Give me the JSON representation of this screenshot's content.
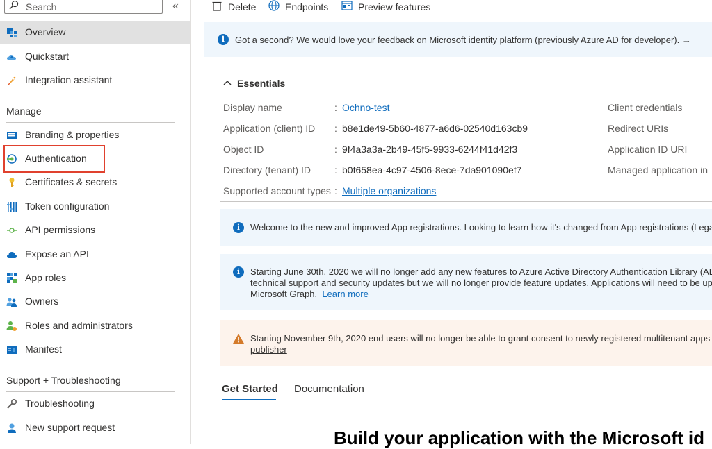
{
  "sidebar": {
    "search_placeholder": "Search",
    "collapse_glyph": "«",
    "items_top": [
      {
        "label": "Overview",
        "icon": "overview-icon"
      },
      {
        "label": "Quickstart",
        "icon": "quickstart-icon"
      },
      {
        "label": "Integration assistant",
        "icon": "rocket-icon"
      }
    ],
    "manage_heading": "Manage",
    "manage_items": [
      {
        "label": "Branding & properties",
        "icon": "branding-icon"
      },
      {
        "label": "Authentication",
        "icon": "authentication-icon"
      },
      {
        "label": "Certificates & secrets",
        "icon": "key-icon"
      },
      {
        "label": "Token configuration",
        "icon": "token-icon"
      },
      {
        "label": "API permissions",
        "icon": "api-permissions-icon"
      },
      {
        "label": "Expose an API",
        "icon": "cloud-icon"
      },
      {
        "label": "App roles",
        "icon": "app-roles-icon"
      },
      {
        "label": "Owners",
        "icon": "owners-icon"
      },
      {
        "label": "Roles and administrators",
        "icon": "roles-icon"
      },
      {
        "label": "Manifest",
        "icon": "manifest-icon"
      }
    ],
    "support_heading": "Support + Troubleshooting",
    "support_items": [
      {
        "label": "Troubleshooting",
        "icon": "wrench-icon"
      },
      {
        "label": "New support request",
        "icon": "support-icon"
      }
    ]
  },
  "toolbar": {
    "delete_label": "Delete",
    "endpoints_label": "Endpoints",
    "preview_label": "Preview features"
  },
  "feedback_banner": {
    "text": "Got a second? We would love your feedback on Microsoft identity platform (previously Azure AD for developer).",
    "arrow": "→"
  },
  "essentials": {
    "heading": "Essentials",
    "rows": [
      {
        "label": "Display name",
        "value": "Ochno-test",
        "link": true
      },
      {
        "label": "Application (client) ID",
        "value": "b8e1de49-5b60-4877-a6d6-02540d163cb9",
        "link": false
      },
      {
        "label": "Object ID",
        "value": "9f4a3a3a-2b49-45f5-9933-6244f41d42f3",
        "link": false
      },
      {
        "label": "Directory (tenant) ID",
        "value": "b0f658ea-4c97-4506-8ece-7da901090ef7",
        "link": false
      },
      {
        "label": "Supported account types",
        "value": "Multiple organizations",
        "link": true
      }
    ],
    "right_labels": [
      "Client credentials",
      "Redirect URIs",
      "Application ID URI",
      "Managed application in"
    ]
  },
  "banners": {
    "welcome": "Welcome to the new and improved App registrations. Looking to learn how it's changed from App registrations (Lega",
    "adal_line1": "Starting June 30th, 2020 we will no longer add any new features to Azure Active Directory Authentication Library (ADA",
    "adal_line2": "technical support and security updates but we will no longer provide feature updates. Applications will need to be up",
    "adal_line3": "Microsoft Graph.",
    "adal_link": "Learn more",
    "warn_line1": "Starting November 9th, 2020 end users will no longer be able to grant consent to newly registered multitenant apps w",
    "warn_link": "publisher"
  },
  "tabs": [
    "Get Started",
    "Documentation"
  ],
  "hero_title": "Build your application with the Microsoft id",
  "colors": {
    "accent": "#0f6cbd",
    "highlight_border": "#e0412e",
    "warning": "#d47a2a"
  }
}
